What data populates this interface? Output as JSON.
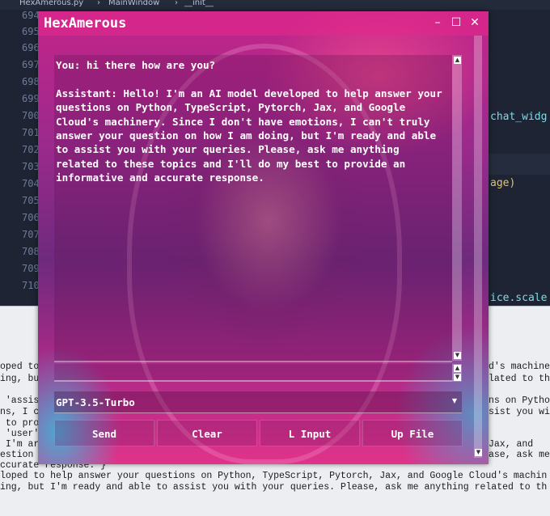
{
  "editor": {
    "tabs": {
      "file": "HexAmerous.py",
      "class": "MainWindow",
      "func": "__init__"
    },
    "line_numbers": [
      "694",
      "695",
      "696",
      "697",
      "698",
      "699",
      "700",
      "701",
      "702",
      "703",
      "704",
      "705",
      "706",
      "707",
      "708",
      "709",
      "710"
    ],
    "code_fragments": {
      "chat_widget": "chat_widg",
      "age": "age)",
      "scale": "ice.scale"
    },
    "terminal_lines": [
      "",
      "",
      "",
      "",
      "oped to",
      "ing, but",
      "",
      " 'assis",
      "ns, I c",
      " to pro",
      " 'user'",
      " I'm ar",
      "estion",
      "ccurate response.'}",
      "loped to help answer your questions on Python, TypeScript, Pytorch, Jax, and Google Cloud's machin",
      "ing, but I'm ready and able to assist you with your queries. Please, ask me anything related to th"
    ],
    "terminal_right_lines": [
      "d's machine",
      "lated to the",
      "",
      "ns on Python",
      "sist you wit",
      "",
      "",
      "Jax, and",
      "ase, ask me a"
    ]
  },
  "app": {
    "title": "HexAmerous",
    "window_buttons": {
      "minimize": "–",
      "maximize": "☐",
      "close": "✕"
    },
    "chat": {
      "text": "You: hi there how are you?\n\nAssistant: Hello! I'm an AI model developed to help answer your\nquestions on Python, TypeScript, Pytorch, Jax, and Google\nCloud's machinery. Since I don't have emotions, I can't truly\nanswer your question on how I am doing, but I'm ready and able\nto assist you with your queries. Please, ask me anything\nrelated to these topics and I'll do my best to provide an\ninformative and accurate response."
    },
    "input": {
      "value": ""
    },
    "model_select": {
      "value": "GPT-3.5-Turbo"
    },
    "buttons": {
      "send": "Send",
      "clear": "Clear",
      "l_input": "L Input",
      "up_file": "Up File"
    }
  },
  "colors": {
    "editor_bg": "#1e2433",
    "terminal_bg": "#eceef2",
    "accent_pink": "#e0338a",
    "window_cyan": "#28c8e6"
  }
}
